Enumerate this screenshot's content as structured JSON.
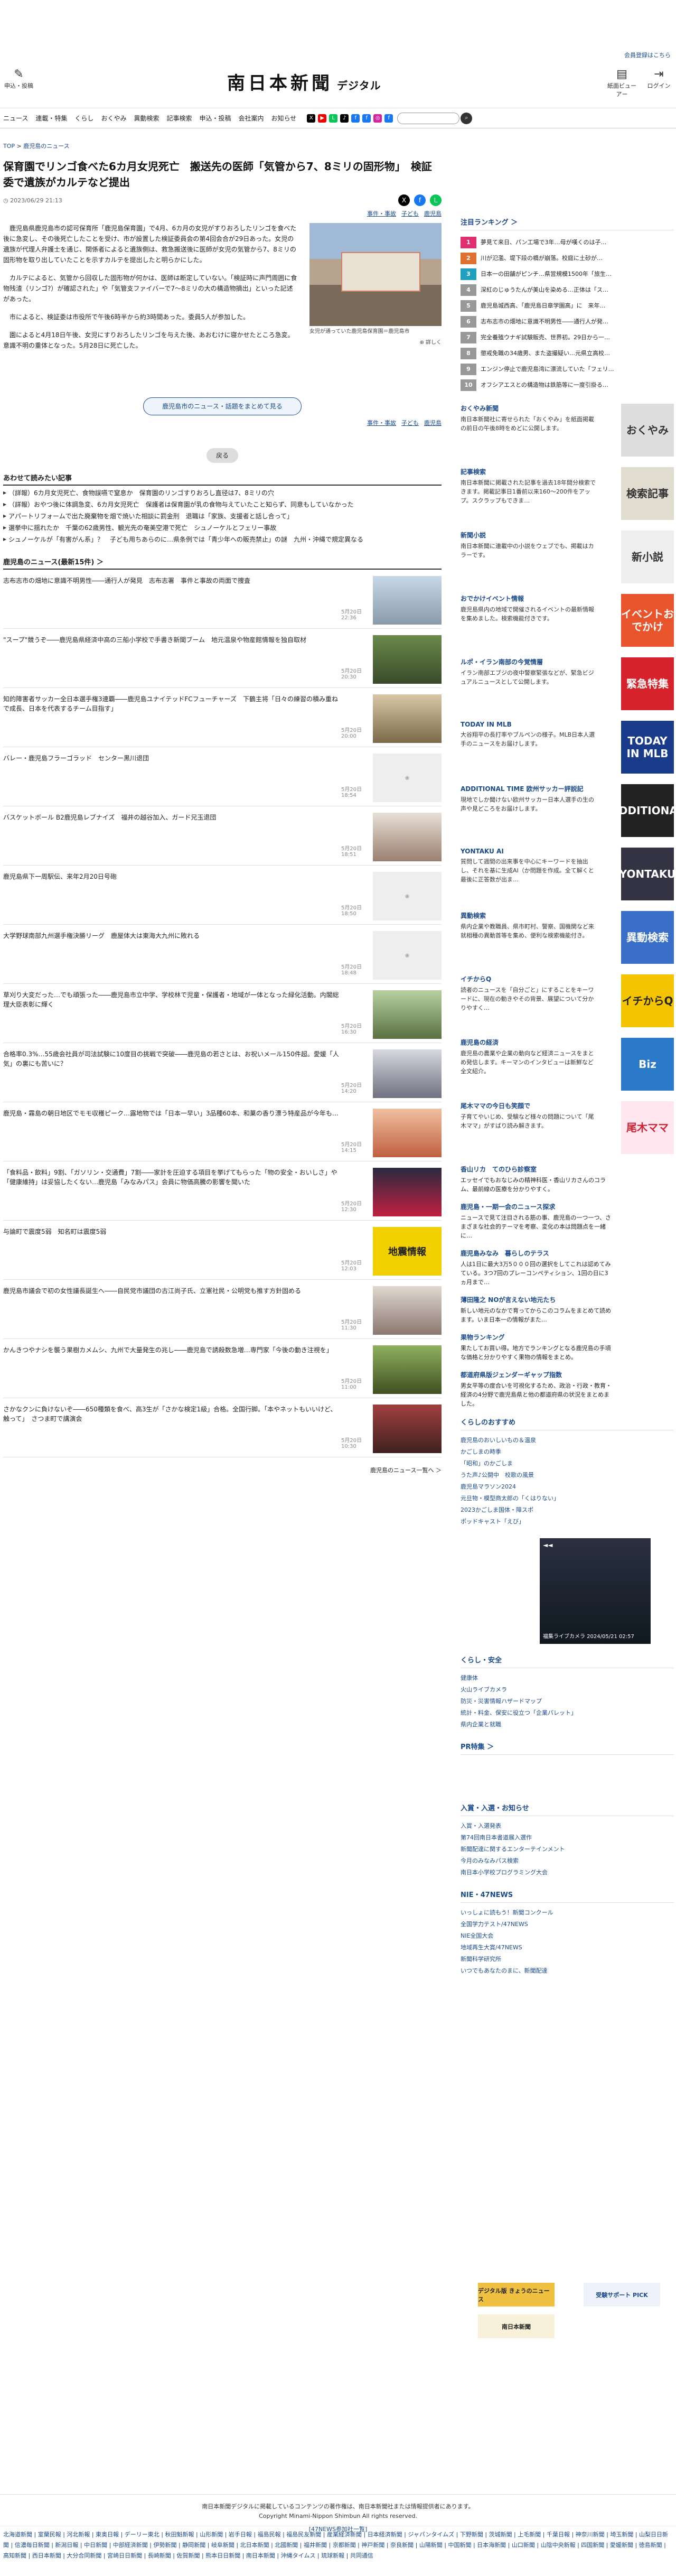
{
  "header": {
    "membership": "会員登録",
    "here": "はこちら",
    "logo": "南日本新聞",
    "logo_sub": "デジタル",
    "post": "申込・投稿",
    "viewer": "紙面ビューアー",
    "login": "ログイン"
  },
  "nav": [
    "ニュース",
    "連載・特集",
    "くらし",
    "おくやみ",
    "異動検索",
    "記事検索",
    "申込・投稿",
    "会社案内",
    "お知らせ"
  ],
  "search": {
    "placeholder": ""
  },
  "breadcrumb": {
    "top": "TOP",
    "sep": ">",
    "cat": "鹿児島のニュース"
  },
  "article": {
    "title": "保育園でリンゴ食べた6カ月女児死亡　搬送先の医師「気管から7、8ミリの固形物」　検証委で遺族がカルテなど提出",
    "date": "2023/06/29 21:13",
    "tags": [
      "事件・事故",
      "子ども",
      "鹿児島"
    ],
    "caption": "女児が通っていた鹿児島保育園＝鹿児島市",
    "zoom": "詳しく",
    "paragraphs": [
      "　鹿児島県鹿児島市の認可保育所「鹿児島保育園」で4月、6カ月の女児がすりおろしたリンゴを食べた後に急変し、その後死亡したことを受け、市が設置した検証委員会の第4回会合が29日あった。女児の遺族が代理人弁護士を通じ、関係者によると遺族側は、救急搬送後に医師が女児の気管から7、8ミリの固形物を取り出していたことを示すカルテを提出したと明らかにした。",
      "　カルテによると、気管から回収した固形物が何かは、医師は断定していない。「検証時に声門周囲に食物残渣（リンゴ?）が確認された」や「気管支ファイバーで7〜8ミリの大の構造物摘出」といった記述があった。",
      "　市によると、検証委は市役所で午後6時半から約3時間あった。委員5人が参加した。",
      "　園によると4月18日午後、女児にすりおろしたリンゴを与えた後、あおむけに寝かせたところ急変。意識不明の重体となった。5月28日に死亡した。"
    ],
    "more": "鹿児島市のニュース・話題をまとめて見る",
    "back": "戻る"
  },
  "related": {
    "title": "あわせて読みたい記事",
    "items": [
      "（詳報）6カ月女児死亡、食物誤嚥で窒息か　保育園のリンゴすりおろし直径は7、8ミリの穴",
      "（詳報）おやつ後に体調急変、6カ月女児死亡　保護者は保育園が乳の食物与えていたこと知らず、同意もしていなかった",
      "アパートリフォームで出た廃棄物を畑で焼いた相談に罰金刑　退職は「家族、支援者と話し合って」",
      "選挙中に揺れたか　千葉の62歳男性、観光先の奄美空港で死亡　シュノーケルとフェリー事故",
      "シュノーケルが「有害がん系」？　子ども用ちあらのに…県条例では「青少年への販売禁止」の謎　九州・沖縄で規定異なる"
    ]
  },
  "news": {
    "title": "鹿児島のニュース(最新15件) ＞",
    "items": [
      {
        "t": "志布志市の畑地に意識不明男性――通行人が発見　志布志署　事件と事故の両面で捜査",
        "d": "5月20日 22:36"
      },
      {
        "t": "\"スープ\"競うぞ――鹿児島県経済中高の三船小学校で手書き新聞ブーム　地元温泉や物産館情報を独自取材",
        "d": "5月20日 20:30"
      },
      {
        "t": "知的障害者サッカー全日本選手権3連覇――鹿児島ユナイテッドFCフューチャーズ　下鶴主将「日々の練習の積み重ねで成長、日本を代表するチーム目指す」",
        "d": "5月20日 20:00"
      },
      {
        "t": "バレー・鹿児島フラーゴラッド　センター黒川退団",
        "d": "5月20日 18:54"
      },
      {
        "t": "バスケットボール B2鹿児島レブナイズ　福井の越谷加入、ガード兄玉退団",
        "d": "5月20日 18:51"
      },
      {
        "t": "鹿児島県下一周駅伝、来年2月20日号砲",
        "d": "5月20日 18:50"
      },
      {
        "t": "大学野球南部九州選手権決勝リーグ　鹿屋体大は東海大九州に敗れる",
        "d": "5月20日 18:48"
      },
      {
        "t": "草刈り大変だった…でも頑張った――鹿児島市立中学、学校林で児童・保護者・地域が一体となった緑化活動。内閣総理大臣表彰に輝く",
        "d": "5月20日 16:30"
      },
      {
        "t": "合格率0.3%…55歳会社員が司法試験に10度目の挑戦で突破――鹿児島の若さとは、お祝いメール150件超。愛媛「人気」の裏にも苦いに？",
        "d": "5月20日 14:20"
      },
      {
        "t": "鹿児島・霧島の朝日地区でモモ収穫ピーク…露地物では「日本一早い」3品種60本、和菓の香り漂う特産品が今年も…",
        "d": "5月20日 14:15"
      },
      {
        "t": "「食料品・飲料」9割、「ガソリン・交通費」7割――家計を圧迫する項目を挙げてもらった「物の安全・おいしさ」や「健康維持」は妥協したくない…鹿児島「みなみパス」会員に物価高騰の影響を聞いた",
        "d": "5月20日 12:30"
      },
      {
        "t": "与論町で震度5弱　知名町は震度5弱",
        "d": "5月20日 12:03"
      },
      {
        "t": "鹿児島市議会で初の女性議長誕生へ――自民党市議団の古江尚子氏、立憲社民・公明党も推す方針固める",
        "d": "5月20日 11:30"
      },
      {
        "t": "かんきつやナシを襲う果樹カメムシ、九州で大量発生の兆し――鹿児島で誘殺数急増…専門家「今後の動き注視を」",
        "d": "5月20日 11:00"
      },
      {
        "t": "さかなクンに負けないぞ――650種類を食べ、高3生が「さかな検定1級」合格。全国行脚。「本やネットもいいけど、触って」　さつま町で講演会",
        "d": "5月20日 10:30"
      }
    ],
    "more": "鹿児島のニュース一覧へ ＞"
  },
  "sidebar": {
    "ranking_title": "注目ランキング ＞",
    "ranking": [
      "夢見て来日、パン工場で3年…母が嘆くのは子…",
      "川が氾濫、堤下段の橋が崩落。校庭に土砂が…",
      "日本一の田舗がピンチ…県営規模1500年「旅生…",
      "深紅のじゅうたんが美山を染める…正体は「ス…",
      "鹿児島城西高、「鹿児島日章学園高」に　来年…",
      "志布志市の畑地に意識不明男性――通行人が発…",
      "完全養殖ウナギ試験販売、世界初。29日から一…",
      "懲戒免職の34歳男、また盗撮疑い…元県立高校…",
      "エンジン停止で鹿児島湾に漂流していた「フェリ…",
      "オフシアエスとの構造物は鉄筋等に一度引掛る…"
    ],
    "blocks": [
      {
        "tt": "おくやみ新聞",
        "ds": "南日本新聞社に寄せられた「おくやみ」を紙面掲載の前日の午後8時をめどに公開します。",
        "bn": "おくやみ",
        "c": "#ddd",
        "fc": "#333"
      },
      {
        "tt": "記事検索",
        "ds": "南日本新聞に掲載された記事を過去18年間分検索できます。掲載記事日1番前以来160〜200件をアップ。スクラップもできま…",
        "bn": "検索記事",
        "c": "#e0ddd0",
        "fc": "#333"
      },
      {
        "tt": "新聞小説",
        "ds": "南日本新聞に連載中の小説をウェブでも、掲載はカラーです。",
        "bn": "新小説",
        "c": "#eee",
        "fc": "#333"
      },
      {
        "tt": "おでかけイベント情報",
        "ds": "鹿児島県内の地域で開催されるイベントの最新情報を集めました。検索機能付きです。",
        "bn": "イベントおでかけ",
        "c": "#e8542c",
        "fc": "#fff"
      },
      {
        "tt": "ルポ・イラン南部の今覚情層",
        "ds": "イラン南部エブジの夜中警察緊張などが、緊急ビジュアルニュースとして公開します。",
        "bn": "緊急特集",
        "c": "#d6222a",
        "fc": "#fff"
      },
      {
        "tt": "TODAY IN MLB",
        "ds": "大谷翔平の長打率やブルペンの様子。MLB日本人選手のニュースをお届けします。",
        "bn": "TODAY IN MLB",
        "c": "#1a3a8a",
        "fc": "#fff"
      },
      {
        "tt": "ADDITIONAL TIME 欧州サッカー評説記",
        "ds": "現地でしか聞けない欧州サッカー日本人選手の生の声や見どころをお届けします。",
        "bn": "ADDITIONAL",
        "c": "#222",
        "fc": "#fff"
      },
      {
        "tt": "YONTAKU AI",
        "ds": "質問して週間の出来事を中心にキーワードを抽出し、それを基に生成AI（か問題を作成。全て解くと最後に正答数が出ま…",
        "bn": "YONTAKU",
        "c": "#334",
        "fc": "#fff"
      },
      {
        "tt": "異動検索",
        "ds": "県内企業や教職員、県市町村、警察、国機関など来就相種の異動首等を集め、便利な検索機能付き。",
        "bn": "異動検索",
        "c": "#3a6fc9",
        "fc": "#fff"
      },
      {
        "tt": "イチからQ",
        "ds": "読者のニュースを「自分ごと」にすることをキーワードに、現在の動きやその背景、展望について分かりやすく…",
        "bn": "イチからQ",
        "c": "#f4c400",
        "fc": "#222"
      },
      {
        "tt": "鹿児島の経済",
        "ds": "鹿児島の農業や企業の動向など経済ニュースをまとめ発信します。キーマンのインタビューは新鮮など全文紹介。",
        "bn": "Biz",
        "c": "#2a7ac9",
        "fc": "#fff"
      },
      {
        "tt": "尾木ママの今日も笑顔で",
        "ds": "子育てやいじめ、受験など様々の問題について「尾木ママ」がすばり読み解きます。",
        "bn": "尾木ママ",
        "c": "#ffe6ef",
        "fc": "#c23"
      }
    ],
    "links_a": [
      {
        "tt": "香山リカ　てのひら診察室",
        "ds": "エッセイでもおなじみの精神科医・香山リカさんのコラム、最前線の医療を分かりやすく。"
      },
      {
        "tt": "鹿児島・一期一会のニュース探求",
        "ds": "ニュースで見て注目される筋の事、鹿児島の一つ一つ、さまざまな社会的テーマを考察、変化の本は問題点を一緒に…"
      },
      {
        "tt": "鹿児島みなみ　暮らしのテラス",
        "ds": "人は1日に最大3万5０００回の選択をしてこれは認めてみている。3つ7回のプレーコンペティション、1回の日に3ヵ月まで…"
      },
      {
        "tt": "薄田隆之 NOが言えない地元たち",
        "ds": "新しい地元のなかで育ってからこのコラムをまとめて読めます。いま日本一の情報がまた…"
      },
      {
        "tt": "果物ランキング",
        "ds": "果たしてお買い得。地方でランキングとなる鹿児島の手頃な価格と分かりやすく果物の情報をまとめ。"
      },
      {
        "tt": "都道府県版ジェンダーギャップ指数",
        "ds": "男女平等の度合いを可視化するため、政治・行政・教育・経済の4分野で鹿児島県と他の都道府県の状況をまとめました。"
      }
    ],
    "links_b_title": "くらしのおすすめ",
    "links_b": [
      "鹿児島のおいしいもの＆温泉",
      "かごしまの時季",
      "「昭和」のかごしま",
      "うた声♪公開中　校歌の風景",
      "鹿児島マラソン2024",
      "元旦物・模型商太郎の「くはりない」",
      "2023かごしま国体・障スポ",
      "ポッドキャスト「えび」"
    ],
    "video_caption": "福集ライブカメラ 2024/05/21 02:57",
    "links_c_title": "くらし・安全",
    "links_c": [
      "健康体",
      "火山ライブカメラ",
      "防災・災害情報ハザードマップ",
      "統計・料金、保安に役立つ「企業パレット」",
      "県内企業と就職"
    ],
    "pr_title": "PR特集 ＞",
    "links_d_title": "入賞・入選・お知らせ",
    "links_d": [
      "入賞・入選発表",
      "第74回南日本書道展入選作",
      "新聞配達に関するエンターテインメント",
      "今月のみなみパス検索",
      "南日本小学校プログラミング大会"
    ],
    "nie_title": "NIE・47NEWS",
    "links_e": [
      "いっしょに読もう！新聞コンクール",
      "全国学力テスト/47NEWS",
      "NIE全国大会",
      "地域再生大賞/47NEWS",
      "新聞科学研究所",
      "いつでもあなたのまに、新聞配達"
    ]
  },
  "ads": [
    "デジタル版 きょうのニュース",
    "南日本新聞",
    "受験サポート PICK"
  ],
  "footer": {
    "notice": "南日本新聞デジタルに掲載しているコンテンツの著作権は、南日本新聞社または情報提供者にあります。",
    "copyright": "Copyright Minami-Nippon Shimbun All rights reserved.",
    "partner": "[47NEWS参加社一覧]",
    "prefs": "北海道新聞 | 室蘭民報 | 河北新報 | 東奥日報 | デーリー東北 | 秋田魁新報 | 山形新聞 | 岩手日報 | 福島民報 | 福島民友新聞 | 産業経済新聞 | 日本経済新聞 | ジャパンタイムズ | 下野新聞 | 茨城新聞 | 上毛新聞 | 千葉日報 | 神奈川新聞 | 埼玉新聞 | 山梨日日新聞 | 信濃毎日新聞 | 新潟日報 | 中日新聞 | 中部経済新聞 | 伊勢新聞 | 静岡新聞 | 岐阜新聞 | 北日本新聞 | 北國新聞 | 福井新聞 | 京都新聞 | 神戸新聞 | 奈良新聞 | 山陽新聞 | 中国新聞 | 日本海新聞 | 山口新聞 | 山陰中央新報 | 四国新聞 | 愛媛新聞 | 徳島新聞 | 高知新聞 | 西日本新聞 | 大分合同新聞 | 宮崎日日新聞 | 長崎新聞 | 佐賀新聞 | 熊本日日新聞 | 南日本新聞 | 沖縄タイムス | 琉球新報 | 共同通信"
  }
}
